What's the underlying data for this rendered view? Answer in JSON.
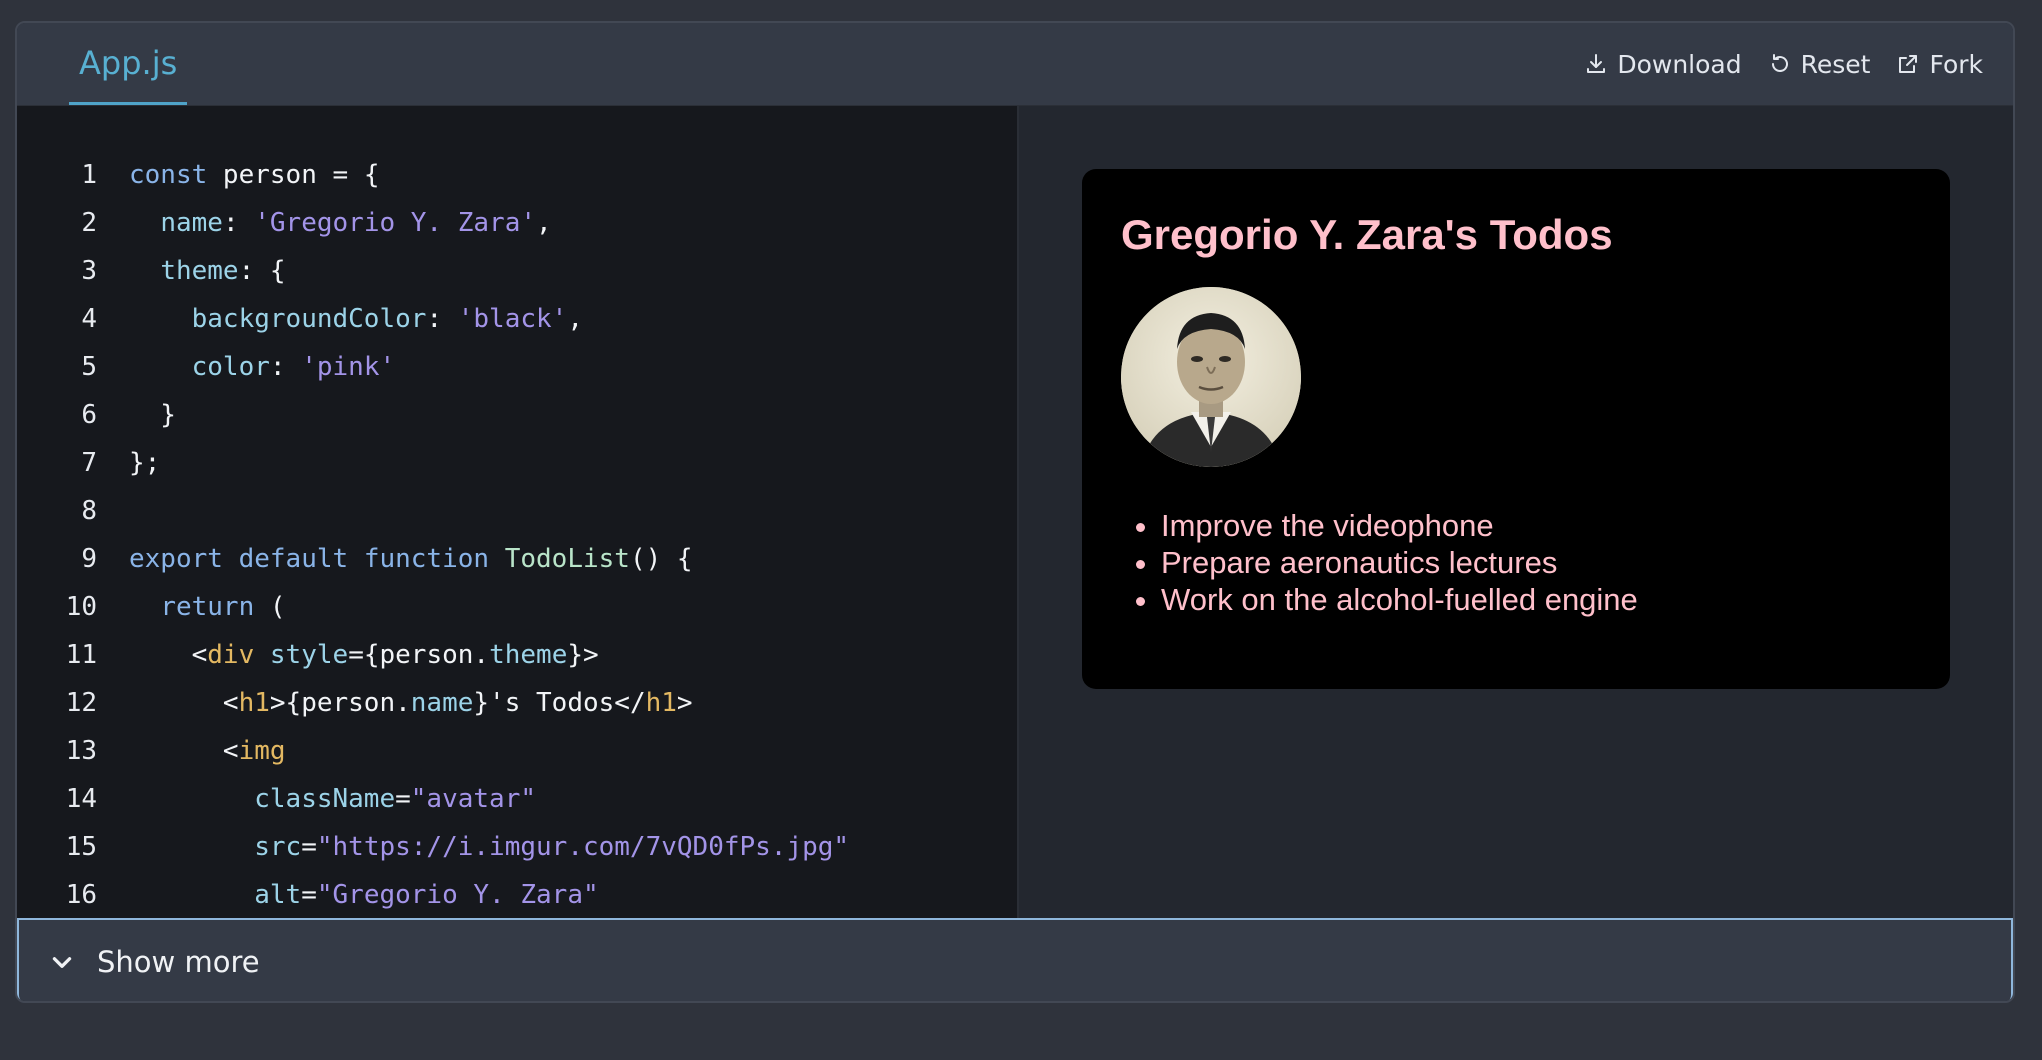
{
  "tab": {
    "label": "App.js"
  },
  "actions": {
    "download": "Download",
    "reset": "Reset",
    "fork": "Fork"
  },
  "code_lines": [
    [
      [
        "kw",
        "const"
      ],
      [
        "txt",
        " person = {"
      ]
    ],
    [
      [
        "txt",
        "  "
      ],
      [
        "prop",
        "name"
      ],
      [
        "txt",
        ": "
      ],
      [
        "str",
        "'Gregorio Y. Zara'"
      ],
      [
        "txt",
        ","
      ]
    ],
    [
      [
        "txt",
        "  "
      ],
      [
        "prop",
        "theme"
      ],
      [
        "txt",
        ": {"
      ]
    ],
    [
      [
        "txt",
        "    "
      ],
      [
        "prop",
        "backgroundColor"
      ],
      [
        "txt",
        ": "
      ],
      [
        "str",
        "'black'"
      ],
      [
        "txt",
        ","
      ]
    ],
    [
      [
        "txt",
        "    "
      ],
      [
        "prop",
        "color"
      ],
      [
        "txt",
        ": "
      ],
      [
        "str",
        "'pink'"
      ]
    ],
    [
      [
        "txt",
        "  }"
      ]
    ],
    [
      [
        "txt",
        "};"
      ]
    ],
    [
      [
        "txt",
        ""
      ]
    ],
    [
      [
        "kw",
        "export"
      ],
      [
        "txt",
        " "
      ],
      [
        "kw",
        "default"
      ],
      [
        "txt",
        " "
      ],
      [
        "kw",
        "function"
      ],
      [
        "txt",
        " "
      ],
      [
        "fn",
        "TodoList"
      ],
      [
        "txt",
        "() {"
      ]
    ],
    [
      [
        "txt",
        "  "
      ],
      [
        "kw",
        "return"
      ],
      [
        "txt",
        " ("
      ]
    ],
    [
      [
        "txt",
        "    <"
      ],
      [
        "tag",
        "div"
      ],
      [
        "txt",
        " "
      ],
      [
        "attr",
        "style"
      ],
      [
        "txt",
        "={person."
      ],
      [
        "prop",
        "theme"
      ],
      [
        "txt",
        "}>"
      ]
    ],
    [
      [
        "txt",
        "      <"
      ],
      [
        "tag",
        "h1"
      ],
      [
        "txt",
        ">{person."
      ],
      [
        "prop",
        "name"
      ],
      [
        "txt",
        "}'s Todos</"
      ],
      [
        "tag",
        "h1"
      ],
      [
        "txt",
        ">"
      ]
    ],
    [
      [
        "txt",
        "      <"
      ],
      [
        "tag",
        "img"
      ]
    ],
    [
      [
        "txt",
        "        "
      ],
      [
        "attr",
        "className"
      ],
      [
        "txt",
        "="
      ],
      [
        "str",
        "\"avatar\""
      ]
    ],
    [
      [
        "txt",
        "        "
      ],
      [
        "attr",
        "src"
      ],
      [
        "txt",
        "="
      ],
      [
        "str",
        "\"https://i.imgur.com/7vQD0fPs.jpg\""
      ]
    ],
    [
      [
        "txt",
        "        "
      ],
      [
        "attr",
        "alt"
      ],
      [
        "txt",
        "="
      ],
      [
        "str",
        "\"Gregorio Y. Zara\""
      ]
    ]
  ],
  "preview": {
    "heading": "Gregorio Y. Zara's Todos",
    "avatar_alt": "Gregorio Y. Zara",
    "todos": [
      "Improve the videophone",
      "Prepare aeronautics lectures",
      "Work on the alcohol-fuelled engine"
    ],
    "background": "#000000",
    "text_color": "#ffc0cb"
  },
  "show_more": "Show more",
  "colors": {
    "page_bg": "#2f333c",
    "header_bg": "#343a46",
    "editor_bg": "#16181d",
    "tab_accent": "#58b0d2"
  }
}
